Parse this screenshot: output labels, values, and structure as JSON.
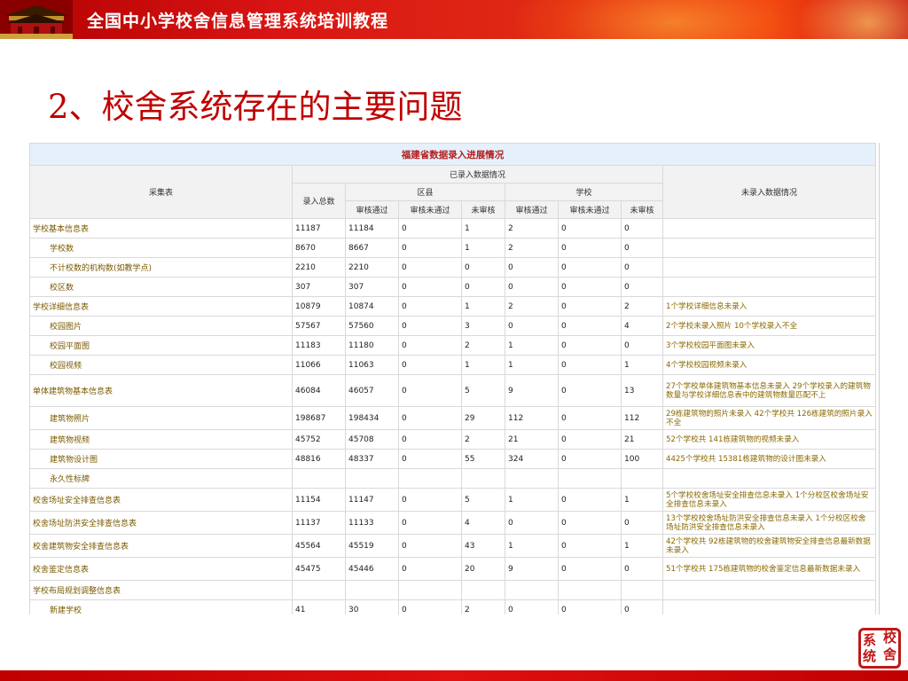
{
  "header": {
    "title": "全国中小学校舍信息管理系统培训教程"
  },
  "slide": {
    "title": "2、校舍系统存在的主要问题"
  },
  "table": {
    "caption": "福建省数据录入进展情况",
    "headers": {
      "collect": "采集表",
      "entered": "已录入数据情况",
      "total": "录入总数",
      "county": "区县",
      "school": "学校",
      "pass": "审核通过",
      "fail": "审核未通过",
      "pending": "未审核",
      "not_entered": "未录入数据情况"
    },
    "rows": [
      {
        "name": "学校基本信息表",
        "sub": false,
        "cells": [
          "11187",
          "11184",
          "0",
          "1",
          "2",
          "0",
          "0"
        ],
        "note": ""
      },
      {
        "name": "学校数",
        "sub": true,
        "cells": [
          "8670",
          "8667",
          "0",
          "1",
          "2",
          "0",
          "0"
        ],
        "note": ""
      },
      {
        "name": "不计校数的机构数(如教学点)",
        "sub": true,
        "cells": [
          "2210",
          "2210",
          "0",
          "0",
          "0",
          "0",
          "0"
        ],
        "note": ""
      },
      {
        "name": "校区数",
        "sub": true,
        "cells": [
          "307",
          "307",
          "0",
          "0",
          "0",
          "0",
          "0"
        ],
        "note": ""
      },
      {
        "name": "学校详细信息表",
        "sub": false,
        "cells": [
          "10879",
          "10874",
          "0",
          "1",
          "2",
          "0",
          "2"
        ],
        "note": "1个学校详细信息未录入"
      },
      {
        "name": "校园图片",
        "sub": true,
        "cells": [
          "57567",
          "57560",
          "0",
          "3",
          "0",
          "0",
          "4"
        ],
        "note": "2个学校未录入照片 10个学校录入不全"
      },
      {
        "name": "校园平面图",
        "sub": true,
        "cells": [
          "11183",
          "11180",
          "0",
          "2",
          "1",
          "0",
          "0"
        ],
        "note": "3个学校校园平面图未录入"
      },
      {
        "name": "校园视频",
        "sub": true,
        "cells": [
          "11066",
          "11063",
          "0",
          "1",
          "1",
          "0",
          "1"
        ],
        "note": "4个学校校园视频未录入"
      },
      {
        "name": "单体建筑物基本信息表",
        "sub": false,
        "cells": [
          "46084",
          "46057",
          "0",
          "5",
          "9",
          "0",
          "13"
        ],
        "note": "27个学校单体建筑物基本信息未录入 29个学校录入的建筑物数量与学校详细信息表中的建筑物数量匹配不上",
        "cls": "tall"
      },
      {
        "name": "建筑物照片",
        "sub": true,
        "cells": [
          "198687",
          "198434",
          "0",
          "29",
          "112",
          "0",
          "112"
        ],
        "note": "29栋建筑物的照片未录入 42个学校共 126栋建筑的照片录入不全",
        "cls": "mid"
      },
      {
        "name": "建筑物视频",
        "sub": true,
        "cells": [
          "45752",
          "45708",
          "0",
          "2",
          "21",
          "0",
          "21"
        ],
        "note": "52个学校共 141栋建筑物的视频未录入"
      },
      {
        "name": "建筑物设计图",
        "sub": true,
        "cells": [
          "48816",
          "48337",
          "0",
          "55",
          "324",
          "0",
          "100"
        ],
        "note": "4425个学校共 15381栋建筑物的设计图未录入"
      },
      {
        "name": "永久性标牌",
        "sub": true,
        "cells": [
          "",
          "",
          "",
          "",
          "",
          "",
          ""
        ],
        "note": ""
      },
      {
        "name": "校舍场址安全排查信息表",
        "sub": false,
        "cells": [
          "11154",
          "11147",
          "0",
          "5",
          "1",
          "0",
          "1"
        ],
        "note": "5个学校校舍场址安全排查信息未录入 1个分校区校舍场址安全排查信息未录入",
        "cls": "mid"
      },
      {
        "name": "校舍场址防洪安全排查信息表",
        "sub": false,
        "cells": [
          "11137",
          "11133",
          "0",
          "4",
          "0",
          "0",
          "0"
        ],
        "note": "13个学校校舍场址防洪安全排查信息未录入 1个分校区校舍场址防洪安全排查信息未录入",
        "cls": "mid"
      },
      {
        "name": "校舍建筑物安全排查信息表",
        "sub": false,
        "cells": [
          "45564",
          "45519",
          "0",
          "43",
          "1",
          "0",
          "1"
        ],
        "note": "42个学校共 92栋建筑物的校舍建筑物安全排查信息最新数据未录入",
        "cls": "mid"
      },
      {
        "name": "校舍鉴定信息表",
        "sub": false,
        "cells": [
          "45475",
          "45446",
          "0",
          "20",
          "9",
          "0",
          "0"
        ],
        "note": "51个学校共 175栋建筑物的校舍鉴定信息最新数据未录入",
        "cls": "mid"
      },
      {
        "name": "学校布局规划调整信息表",
        "sub": false,
        "cells": [
          "",
          "",
          "",
          "",
          "",
          "",
          ""
        ],
        "note": ""
      },
      {
        "name": "新建学校",
        "sub": true,
        "cells": [
          "41",
          "30",
          "0",
          "2",
          "0",
          "0",
          "0"
        ],
        "note": ""
      }
    ]
  },
  "seal": {
    "chars": [
      "系",
      "校",
      "统",
      "舍"
    ]
  }
}
